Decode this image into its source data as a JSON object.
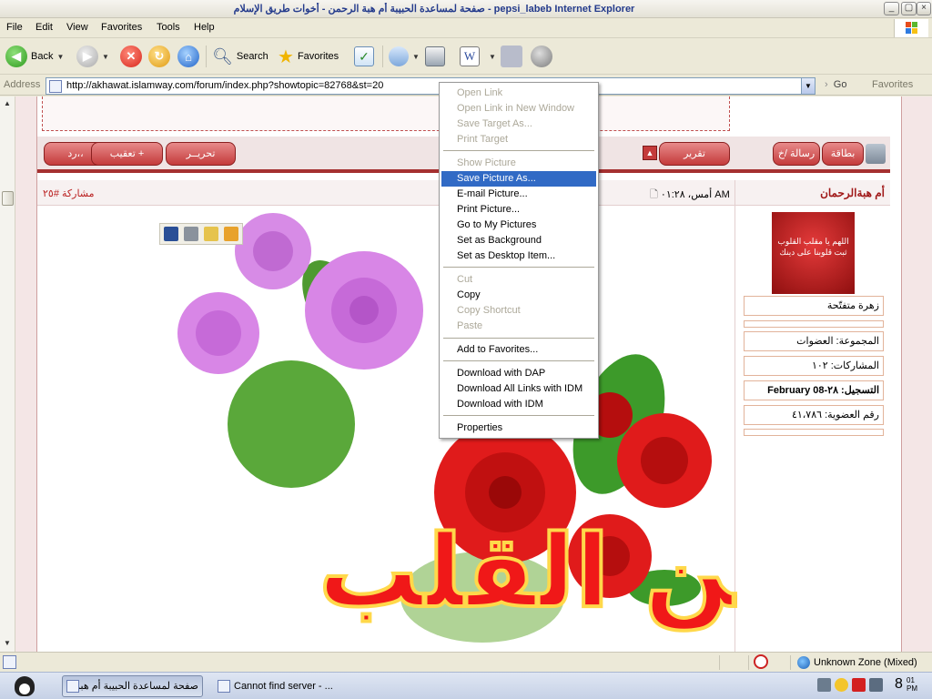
{
  "window": {
    "title": "صفحة لمساعدة الحبيبة أم هبة الرحمن - أخوات طريق الإسلام - pepsi_labeb Internet Explorer",
    "minimize": "_",
    "close": "×"
  },
  "menubar": [
    "File",
    "Edit",
    "View",
    "Favorites",
    "Tools",
    "Help"
  ],
  "toolbar": {
    "back_label": "Back",
    "search_label": "Search",
    "favorites_label": "Favorites"
  },
  "address": {
    "label": "Address",
    "url": "http://akhawat.islamway.com/forum/index.php?showtopic=82768&st=20",
    "go_label": "Go",
    "links_label": "Favorites"
  },
  "forum": {
    "buttons_left": [
      "رد،،",
      "تعقيب +",
      "تحريــر"
    ],
    "button_report": "تقرير",
    "buttons_right": [
      "رسالة /خ",
      "بطاقة"
    ],
    "post_number": "مشاركة #٢٥",
    "post_date": "أمس، ٠١:٢٨ AM",
    "post_author": "أم هبةالرحمان",
    "avatar_text": "اللهم يا مقلب القلوب ثبت قلوبنا على دينك",
    "user_title": "زهرة متفتّحة",
    "group": "المجموعة: العضوات",
    "posts": "المشاركات: ١٠٢",
    "joined": "التسجيل: ٢٨-February 08",
    "member_no": "رقم العضوية: ٤١،٧٨٦",
    "image_text": "من القلب"
  },
  "context_menu": {
    "items": [
      {
        "label": "Open Link",
        "state": "disabled"
      },
      {
        "label": "Open Link in New Window",
        "state": "disabled"
      },
      {
        "label": "Save Target As...",
        "state": "disabled"
      },
      {
        "label": "Print Target",
        "state": "disabled"
      },
      {
        "label": "Show Picture",
        "state": "disabled"
      },
      {
        "label": "Save Picture As...",
        "state": "selected"
      },
      {
        "label": "E-mail Picture...",
        "state": "enabled"
      },
      {
        "label": "Print Picture...",
        "state": "enabled"
      },
      {
        "label": "Go to My Pictures",
        "state": "enabled"
      },
      {
        "label": "Set as Background",
        "state": "enabled"
      },
      {
        "label": "Set as Desktop Item...",
        "state": "enabled"
      },
      {
        "label": "Cut",
        "state": "disabled"
      },
      {
        "label": "Copy",
        "state": "enabled"
      },
      {
        "label": "Copy Shortcut",
        "state": "disabled"
      },
      {
        "label": "Paste",
        "state": "disabled"
      },
      {
        "label": "Add to Favorites...",
        "state": "enabled"
      },
      {
        "label": "Download with DAP",
        "state": "enabled"
      },
      {
        "label": "Download All Links with IDM",
        "state": "enabled"
      },
      {
        "label": "Download with IDM",
        "state": "enabled"
      },
      {
        "label": "Properties",
        "state": "enabled"
      }
    ]
  },
  "statusbar": {
    "zone": "Unknown Zone (Mixed)"
  },
  "taskbar": {
    "tasks": [
      "صفحة لمساعدة الحبيبة أم هبة...",
      "Cannot find server - ..."
    ],
    "clock_hour": "8",
    "clock_min": "01",
    "clock_ampm": "PM"
  },
  "colors": {
    "accent_red": "#c43b3b",
    "menu_highlight": "#316ac5",
    "xp_face": "#ece9d8"
  }
}
